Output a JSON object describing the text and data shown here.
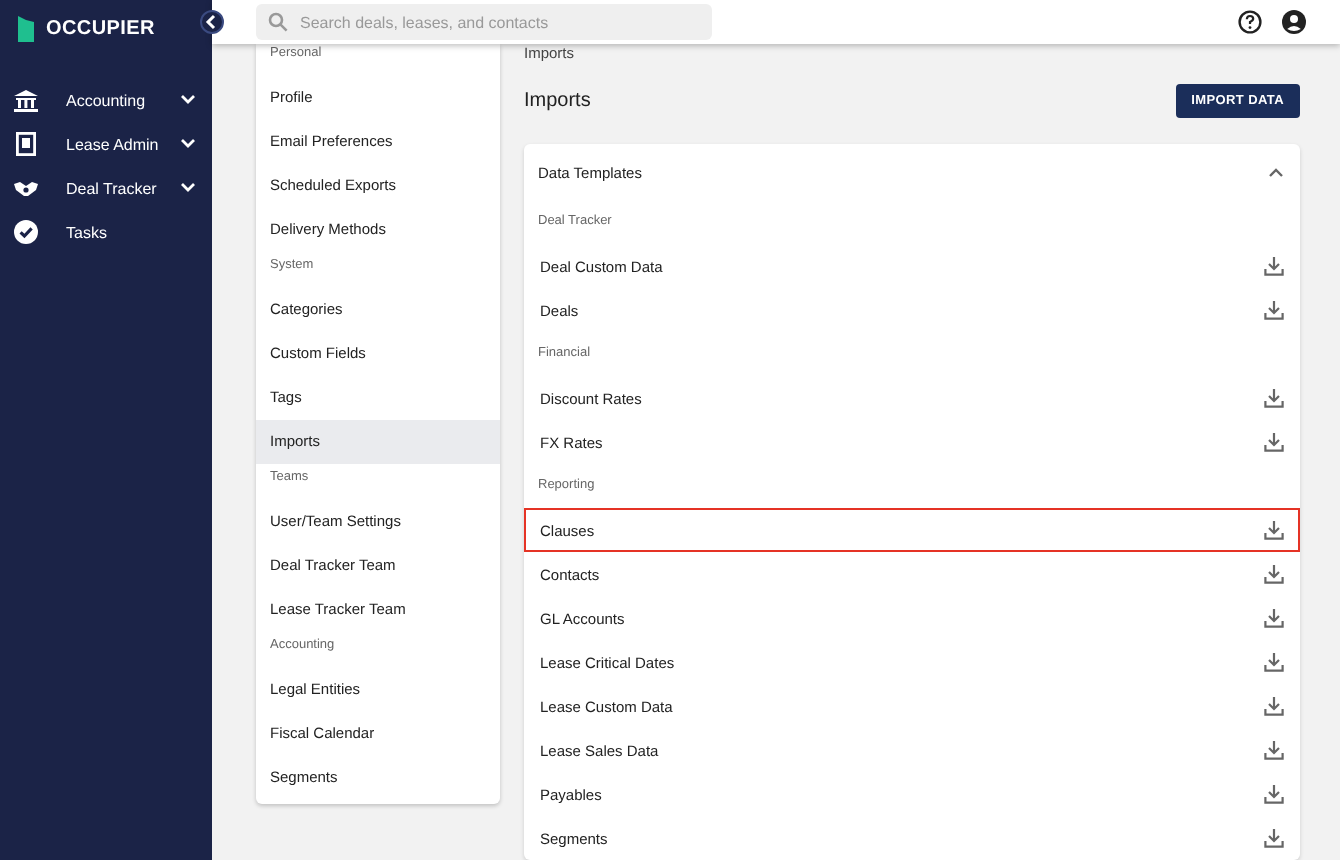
{
  "sidebar": {
    "logo": "OCCUPIER",
    "items": [
      {
        "label": "Accounting",
        "has_submenu": true
      },
      {
        "label": "Lease Admin",
        "has_submenu": true
      },
      {
        "label": "Deal Tracker",
        "has_submenu": true
      },
      {
        "label": "Tasks",
        "has_submenu": false
      }
    ]
  },
  "header": {
    "search": {
      "placeholder": "Search deals, leases, and contacts"
    }
  },
  "settings_menu": [
    {
      "title": "Personal",
      "items": [
        {
          "label": "Profile",
          "selected": false
        },
        {
          "label": "Email Preferences",
          "selected": false
        },
        {
          "label": "Scheduled Exports",
          "selected": false
        },
        {
          "label": "Delivery Methods",
          "selected": false
        }
      ]
    },
    {
      "title": "System",
      "items": [
        {
          "label": "Categories",
          "selected": false
        },
        {
          "label": "Custom Fields",
          "selected": false
        },
        {
          "label": "Tags",
          "selected": false
        },
        {
          "label": "Imports",
          "selected": true
        }
      ]
    },
    {
      "title": "Teams",
      "items": [
        {
          "label": "User/Team Settings",
          "selected": false
        },
        {
          "label": "Deal Tracker Team",
          "selected": false
        },
        {
          "label": "Lease Tracker Team",
          "selected": false
        }
      ]
    },
    {
      "title": "Accounting",
      "items": [
        {
          "label": "Legal Entities",
          "selected": false
        },
        {
          "label": "Fiscal Calendar",
          "selected": false
        },
        {
          "label": "Segments",
          "selected": false
        }
      ]
    }
  ],
  "page": {
    "breadcrumb": "Imports",
    "title": "Imports",
    "button": "IMPORT DATA",
    "card": {
      "title": "Data Templates",
      "expanded": true,
      "groups": [
        {
          "title": "Deal Tracker",
          "items": [
            {
              "label": "Deal Custom Data",
              "highlighted": false
            },
            {
              "label": "Deals",
              "highlighted": false
            }
          ]
        },
        {
          "title": "Financial",
          "items": [
            {
              "label": "Discount Rates",
              "highlighted": false
            },
            {
              "label": "FX Rates",
              "highlighted": false
            }
          ]
        },
        {
          "title": "Reporting",
          "items": [
            {
              "label": "Clauses",
              "highlighted": true
            },
            {
              "label": "Contacts",
              "highlighted": false
            },
            {
              "label": "GL Accounts",
              "highlighted": false
            },
            {
              "label": "Lease Critical Dates",
              "highlighted": false
            },
            {
              "label": "Lease Custom Data",
              "highlighted": false
            },
            {
              "label": "Lease Sales Data",
              "highlighted": false
            },
            {
              "label": "Payables",
              "highlighted": false
            },
            {
              "label": "Segments",
              "highlighted": false
            }
          ]
        }
      ]
    }
  }
}
